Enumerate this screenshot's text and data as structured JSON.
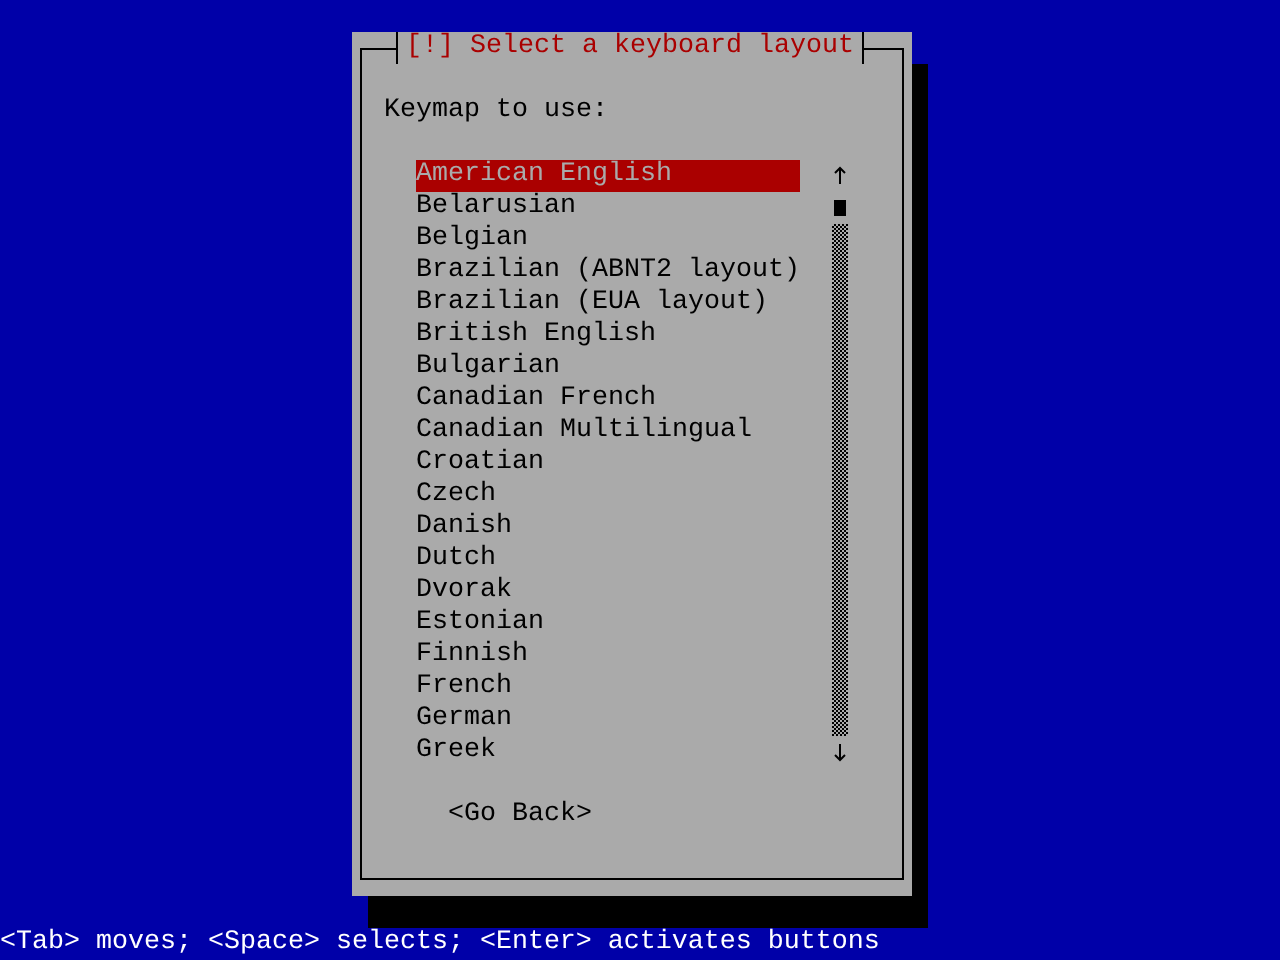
{
  "dialog": {
    "title": "[!] Select a keyboard layout",
    "prompt": "Keymap to use:",
    "keymaps": [
      {
        "label": "American English",
        "selected": true
      },
      {
        "label": "Belarusian",
        "selected": false
      },
      {
        "label": "Belgian",
        "selected": false
      },
      {
        "label": "Brazilian (ABNT2 layout)",
        "selected": false
      },
      {
        "label": "Brazilian (EUA layout)",
        "selected": false
      },
      {
        "label": "British English",
        "selected": false
      },
      {
        "label": "Bulgarian",
        "selected": false
      },
      {
        "label": "Canadian French",
        "selected": false
      },
      {
        "label": "Canadian Multilingual",
        "selected": false
      },
      {
        "label": "Croatian",
        "selected": false
      },
      {
        "label": "Czech",
        "selected": false
      },
      {
        "label": "Danish",
        "selected": false
      },
      {
        "label": "Dutch",
        "selected": false
      },
      {
        "label": "Dvorak",
        "selected": false
      },
      {
        "label": "Estonian",
        "selected": false
      },
      {
        "label": "Finnish",
        "selected": false
      },
      {
        "label": "French",
        "selected": false
      },
      {
        "label": "German",
        "selected": false
      },
      {
        "label": "Greek",
        "selected": false
      }
    ],
    "button": "<Go Back>"
  },
  "status_bar": "<Tab> moves; <Space> selects; <Enter> activates buttons"
}
